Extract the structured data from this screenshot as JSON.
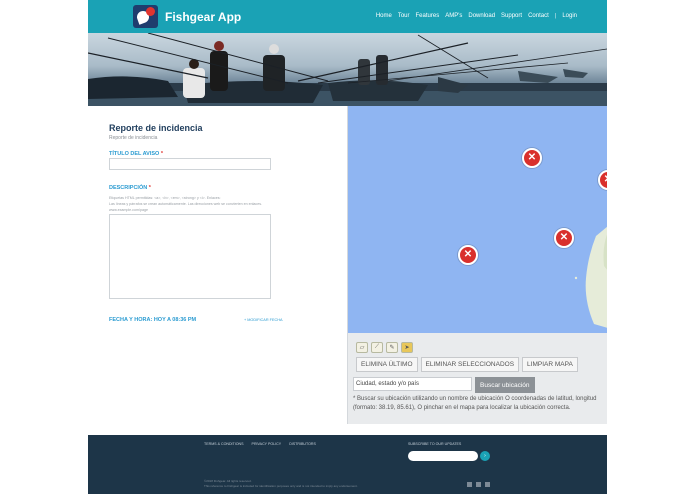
{
  "header": {
    "app_name": "Fishgear App",
    "nav": [
      "Home",
      "Tour",
      "Features",
      "AMP's",
      "Download",
      "Support",
      "Contact",
      "|",
      "Login"
    ]
  },
  "form": {
    "title": "Reporte de incidencia",
    "subtitle": "Reporte de incidencia",
    "title_field_label": "TÍTULO DEL AVISO",
    "required_mark": "*",
    "description_label": "DESCRIPCIÓN",
    "help_line_1": "Etiquetas HTML permitidas: <a>, <b>, <em>, <strong> y <i>. Enlaces:",
    "help_line_2": "Las líneas y párrafos se crean automáticamente. Las direcciones web se convierten en enlaces.",
    "help_line_3": "www.example.com/page",
    "date_label": "FECHA Y HORA: HOY A 08:36 PM",
    "modify_link": "+ MODIFICAR FECHA"
  },
  "map": {
    "buttons": [
      "ELIMINA ÚLTIMO",
      "ELIMINAR SELECCIONADOS",
      "LIMPIAR MAPA"
    ],
    "address_value": "Ciudad, estado y/o país",
    "search_button": "Buscar ubicación",
    "help_text": "* Buscar su ubicación utilizando un nombre de ubicación O coordenadas de latitud, longitud (formato: 38.19, 85.61), O pinchar en el mapa para localizar la ubicación correcta.",
    "marker_glyph": "✕",
    "tool_icons": [
      "polygon-tool-icon",
      "line-tool-icon",
      "pencil-tool-icon",
      "point-tool-icon"
    ],
    "tool_glyphs": [
      "▱",
      "⟋",
      "✎",
      "➤"
    ],
    "water_color": "#8fb5f2",
    "marker_color": "#d9302c"
  },
  "footer": {
    "links": [
      "TERMS & CONDITIONS",
      "PRIVACY POLICY",
      "DISTRIBUTORS"
    ],
    "subscribe_label": "SUBSCRIBE TO OUR UPDATES",
    "subscribe_button": "›",
    "copyright_1": "©2018 Fishgear. All rights reserved.",
    "copyright_2": "This reference to Fishgear is included for identification purposes only and is not intended to imply any endorsement."
  },
  "colors": {
    "brand_teal": "#1aa2b5",
    "footer_navy": "#1d3548",
    "link_blue": "#2a9bd1",
    "required_red": "#e0342f"
  }
}
